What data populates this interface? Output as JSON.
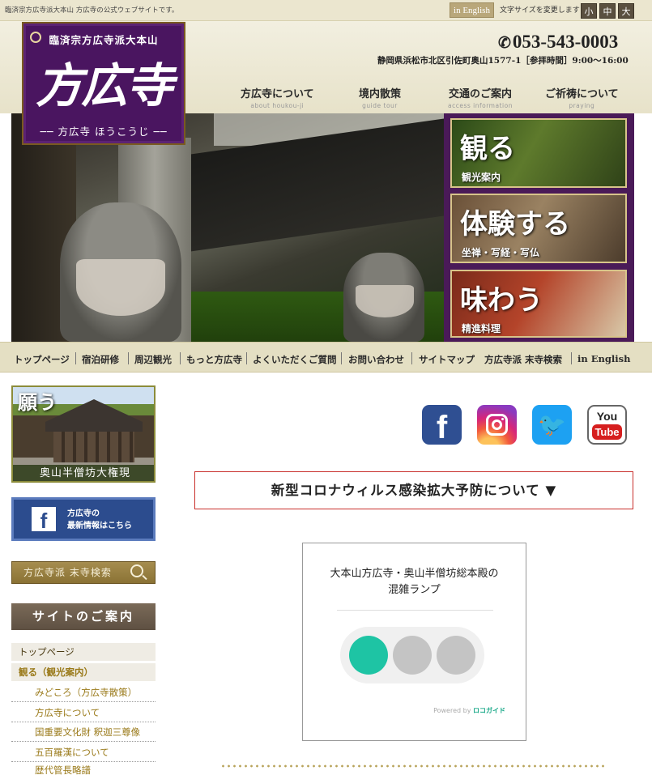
{
  "topbar": {
    "description": "臨済宗方広寺派大本山 方広寺の公式ウェブサイトです。",
    "in_english": "in English",
    "font_size_label": "文字サイズを変更します",
    "font_sizes": [
      "小",
      "中",
      "大"
    ]
  },
  "logo": {
    "top": "臨済宗方広寺派大本山",
    "main": "方広寺",
    "bottom": "── 方広寺 ほうこうじ ──"
  },
  "contact": {
    "phone": "053-543-0003",
    "address": "静岡県浜松市北区引佐町奥山1577-1［参拝時間］9:00〜16:00"
  },
  "global_nav": [
    {
      "jp": "方広寺について",
      "en": "about houkou-ji"
    },
    {
      "jp": "境内散策",
      "en": "guide tour"
    },
    {
      "jp": "交通のご案内",
      "en": "access information"
    },
    {
      "jp": "ご祈祷について",
      "en": "praying"
    }
  ],
  "banners": [
    {
      "big": "観る",
      "small": "観光案内"
    },
    {
      "big": "体験する",
      "small": "坐禅・写経・写仏"
    },
    {
      "big": "味わう",
      "small": "精進料理"
    }
  ],
  "sub_nav": [
    "トップページ",
    "宿泊研修",
    "周辺観光",
    "もっと方広寺",
    "よくいただくご質問",
    "お問い合わせ",
    "サイトマップ",
    "方広寺派 末寺検索",
    "in English"
  ],
  "sidebar": {
    "negau": "願う",
    "negau_caption": "奥山半僧坊大権現",
    "fb_line1": "方広寺の",
    "fb_line2": "最新情報はこちら",
    "search_label": "方広寺派 末寺検索",
    "site_guide": "サイトのご案内",
    "menu": [
      {
        "label": "トップページ",
        "level": 1
      },
      {
        "label": "観る（観光案内）",
        "level": 1
      },
      {
        "label": "みどころ（方広寺散策）",
        "level": 2
      },
      {
        "label": "方広寺について",
        "level": 2
      },
      {
        "label": "国重要文化財 釈迦三尊像",
        "level": 2
      },
      {
        "label": "五百羅漢について",
        "level": 2
      },
      {
        "label": "歴代管長略譜",
        "level": 2
      }
    ]
  },
  "sns": {
    "facebook": "f",
    "twitter": "🐦",
    "youtube_you": "You",
    "youtube_tube": "Tube"
  },
  "notice": "新型コロナウィルス感染拡大予防について ▼",
  "lamp": {
    "title_line1": "大本山方広寺・奥山半僧坊総本殿の",
    "title_line2": "混雑ランプ",
    "powered_by": "Powered by",
    "brand": "ロコガイド",
    "active_color": "#1ec4a4",
    "inactive_color": "#c4c4c4"
  }
}
